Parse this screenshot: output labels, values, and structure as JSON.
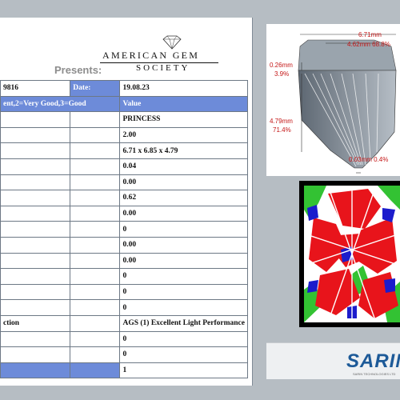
{
  "header": {
    "presents": "Presents:",
    "ags_line1": "AMERICAN GEM",
    "ags_line2": "SOCIETY"
  },
  "table": {
    "rows": [
      {
        "a": "9816",
        "b": "Date:",
        "c": "19.08.23",
        "b_blue": true,
        "a_blue": false,
        "c_blue": false
      },
      {
        "a": "ent,2=Very Good,3=Good",
        "b": "",
        "c": "Value",
        "a_blue": true,
        "b_blue": false,
        "c_blue": true,
        "merge_ab": true
      },
      {
        "a": "",
        "b": "",
        "c": "PRINCESS"
      },
      {
        "a": "",
        "b": "",
        "c": "2.00"
      },
      {
        "a": "",
        "b": "",
        "c": "6.71 x 6.85 x 4.79"
      },
      {
        "a": "",
        "b": "",
        "c": "0.04"
      },
      {
        "a": "",
        "b": "",
        "c": "0.00"
      },
      {
        "a": "",
        "b": "",
        "c": "0.62"
      },
      {
        "a": "",
        "b": "",
        "c": "0.00"
      },
      {
        "a": "",
        "b": "",
        "c": "0"
      },
      {
        "a": "",
        "b": "",
        "c": "0.00"
      },
      {
        "a": "",
        "b": "",
        "c": "0.00"
      },
      {
        "a": "",
        "b": "",
        "c": "0"
      },
      {
        "a": "",
        "b": "",
        "c": "0"
      },
      {
        "a": "",
        "b": "",
        "c": "0"
      },
      {
        "a": "ction",
        "b": "",
        "c": "AGS (1) Excellent Light Performance"
      },
      {
        "a": "",
        "b": "",
        "c": "0"
      },
      {
        "a": "",
        "b": "",
        "c": "0"
      },
      {
        "a": "",
        "b": "",
        "c": "1",
        "a_blue": true,
        "b_blue": true
      }
    ]
  },
  "diagram": {
    "width_label": "6.71mm",
    "table_label": "4.62mm 68.8%",
    "crown_label_mm": "0.26mm",
    "crown_label_pct": "3.9%",
    "depth_label_mm": "4.79mm",
    "depth_label_pct": "71.4%",
    "culet_label": "0.03mm 0.4%"
  },
  "brand": {
    "name": "SARIN",
    "sub": "SARIN TECHNOLOGIES LTD"
  },
  "colors": {
    "accent_blue": "#6d8bd9",
    "dim_red": "#c41616",
    "aset_red": "#e8141b",
    "aset_green": "#33c233",
    "aset_blue": "#1c1ccc"
  }
}
